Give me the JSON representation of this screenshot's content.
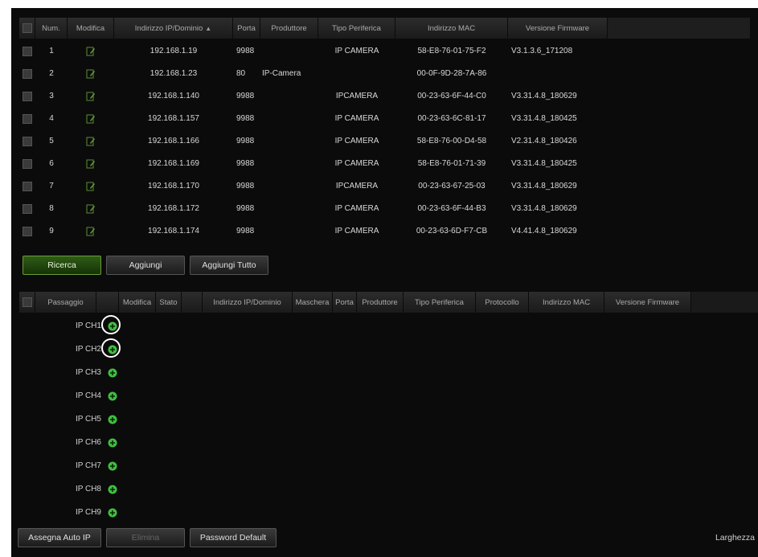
{
  "device_table": {
    "headers": {
      "num": "Num.",
      "edit": "Modifica",
      "ip": "Indirizzo IP/Dominio",
      "ip_sort": "▲",
      "port": "Porta",
      "manufacturer": "Produttore",
      "device_type": "Tipo Periferica",
      "mac": "Indirizzo MAC",
      "firmware": "Versione Firmware"
    },
    "rows": [
      {
        "num": "1",
        "ip": "192.168.1.19",
        "port": "9988",
        "manufacturer": "",
        "type": "IP CAMERA",
        "mac": "58-E8-76-01-75-F2",
        "fw": "V3.1.3.6_171208"
      },
      {
        "num": "2",
        "ip": "192.168.1.23",
        "port": "80",
        "manufacturer": "IP-Camera",
        "type": "",
        "mac": "00-0F-9D-28-7A-86",
        "fw": ""
      },
      {
        "num": "3",
        "ip": "192.168.1.140",
        "port": "9988",
        "manufacturer": "",
        "type": "IPCAMERA",
        "mac": "00-23-63-6F-44-C0",
        "fw": "V3.31.4.8_180629"
      },
      {
        "num": "4",
        "ip": "192.168.1.157",
        "port": "9988",
        "manufacturer": "",
        "type": "IP CAMERA",
        "mac": "00-23-63-6C-81-17",
        "fw": "V3.31.4.8_180425"
      },
      {
        "num": "5",
        "ip": "192.168.1.166",
        "port": "9988",
        "manufacturer": "",
        "type": "IP CAMERA",
        "mac": "58-E8-76-00-D4-58",
        "fw": "V2.31.4.8_180426"
      },
      {
        "num": "6",
        "ip": "192.168.1.169",
        "port": "9988",
        "manufacturer": "",
        "type": "IP CAMERA",
        "mac": "58-E8-76-01-71-39",
        "fw": "V3.31.4.8_180425"
      },
      {
        "num": "7",
        "ip": "192.168.1.170",
        "port": "9988",
        "manufacturer": "",
        "type": "IPCAMERA",
        "mac": "00-23-63-67-25-03",
        "fw": "V3.31.4.8_180629"
      },
      {
        "num": "8",
        "ip": "192.168.1.172",
        "port": "9988",
        "manufacturer": "",
        "type": "IP CAMERA",
        "mac": "00-23-63-6F-44-B3",
        "fw": "V3.31.4.8_180629"
      },
      {
        "num": "9",
        "ip": "192.168.1.174",
        "port": "9988",
        "manufacturer": "",
        "type": "IP CAMERA",
        "mac": "00-23-63-6D-F7-CB",
        "fw": "V4.41.4.8_180629"
      }
    ]
  },
  "buttons": {
    "search": "Ricerca",
    "add": "Aggiungi",
    "add_all": "Aggiungi Tutto",
    "auto_ip": "Assegna Auto IP",
    "delete": "Elimina",
    "default_password": "Password Default"
  },
  "channel_table": {
    "headers": {
      "channel": "Passaggio",
      "edit": "Modifica",
      "status": "Stato",
      "ip": "Indirizzo IP/Dominio",
      "mask": "Maschera",
      "port": "Porta",
      "manufacturer": "Produttore",
      "device_type": "Tipo Periferica",
      "protocol": "Protocollo",
      "mac": "Indirizzo MAC",
      "firmware": "Versione Firmware"
    },
    "channels": [
      "IP CH1",
      "IP CH2",
      "IP CH3",
      "IP CH4",
      "IP CH5",
      "IP CH6",
      "IP CH7",
      "IP CH8",
      "IP CH9"
    ]
  },
  "footer": {
    "bandwidth_label": "Larghezza"
  },
  "colors": {
    "add_icon": "#3fbf3f",
    "highlight_ring": "#ffffff",
    "active_button": "#2f5c18"
  },
  "icons": {
    "edit": "edit-icon",
    "add": "add-circle-icon"
  }
}
